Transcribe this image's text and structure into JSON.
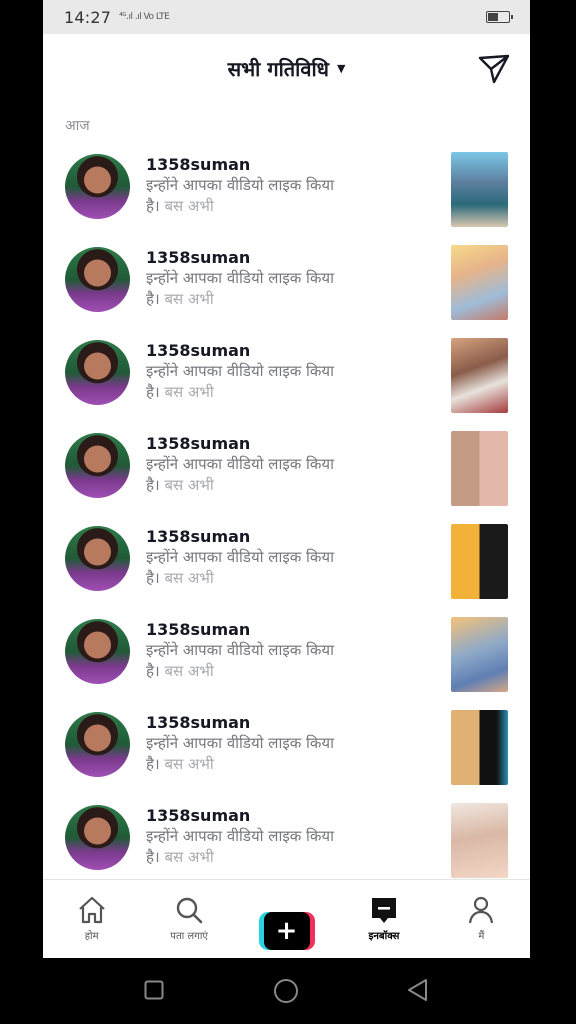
{
  "status_bar": {
    "time": "14:27",
    "signal_text": "⁴ᴳ.ıl .ıl Vo LTE"
  },
  "header": {
    "title": "सभी गतिविधि",
    "caret": "▼"
  },
  "section": {
    "label": "आज"
  },
  "notifications": [
    {
      "username": "1358suman",
      "message": "इन्होंने आपका वीडियो लाइक किया",
      "suffix": "है।",
      "time": "बस अभी"
    },
    {
      "username": "1358suman",
      "message": "इन्होंने आपका वीडियो लाइक किया",
      "suffix": "है।",
      "time": "बस अभी"
    },
    {
      "username": "1358suman",
      "message": "इन्होंने आपका वीडियो लाइक किया",
      "suffix": "है।",
      "time": "बस अभी"
    },
    {
      "username": "1358suman",
      "message": "इन्होंने आपका वीडियो लाइक किया",
      "suffix": "है।",
      "time": "बस अभी"
    },
    {
      "username": "1358suman",
      "message": "इन्होंने आपका वीडियो लाइक किया",
      "suffix": "है।",
      "time": "बस अभी"
    },
    {
      "username": "1358suman",
      "message": "इन्होंने आपका वीडियो लाइक किया",
      "suffix": "है।",
      "time": "बस अभी"
    },
    {
      "username": "1358suman",
      "message": "इन्होंने आपका वीडियो लाइक किया",
      "suffix": "है।",
      "time": "बस अभी"
    },
    {
      "username": "1358suman",
      "message": "इन्होंने आपका वीडियो लाइक किया",
      "suffix": "है।",
      "time": "बस अभी"
    }
  ],
  "tabbar": {
    "home": "होम",
    "discover": "पता लगाएं",
    "create": "+",
    "inbox": "इनबॉक्स",
    "profile": "मैं"
  },
  "colors": {
    "create_left": "#2ad3e0",
    "create_right": "#f0305a"
  }
}
